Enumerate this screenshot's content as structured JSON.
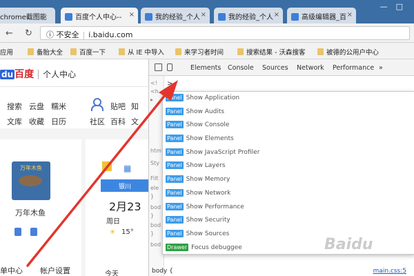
{
  "browser": {
    "tabs": [
      {
        "label": "chrome截图能"
      },
      {
        "label": "百度个人中心--"
      },
      {
        "label": "我的经验_个人"
      },
      {
        "label": "我的经验_个人"
      },
      {
        "label": "高级编辑器_百"
      }
    ],
    "url": "i.baidu.com",
    "security_label": "不安全",
    "bookmarks": [
      "应用",
      "备胎大全",
      "百度一下",
      "从 IE 中导入",
      "来学习者时间",
      "搜索结果 - 沃森搜客",
      "被德的公用户中心"
    ]
  },
  "page": {
    "logo_text": "百度",
    "logo_du": "du",
    "header_title": "个人中心",
    "menu_row1": [
      "搜索",
      "云盘",
      "糯米"
    ],
    "menu_row2": [
      "文库",
      "收藏",
      "日历"
    ],
    "menu_right1": [
      "贴吧",
      "知"
    ],
    "menu_right2": [
      "社区",
      "百科",
      "文"
    ],
    "avatar_label": "万年木鱼",
    "fish_caption": "万年木鱼",
    "date": "2月23",
    "weekday": "周日",
    "temp": "15°",
    "bottom_links": [
      "单中心",
      "帐户设置"
    ],
    "today_label": "今天",
    "blue_btn_label": "银川"
  },
  "devtools": {
    "tabs": [
      "Elements",
      "Console",
      "Sources",
      "Network",
      "Performance",
      "»"
    ],
    "prompt": ">",
    "gutter": [
      "<!",
      "<h",
      "▸",
      "htm",
      "Sty",
      "Filt",
      "ele",
      "}",
      "bod",
      "}",
      "bod",
      "}",
      "bod"
    ],
    "commands": [
      {
        "badge": "Panel",
        "text": "Show Application"
      },
      {
        "badge": "Panel",
        "text": "Show Audits"
      },
      {
        "badge": "Panel",
        "text": "Show Console"
      },
      {
        "badge": "Panel",
        "text": "Show Elements"
      },
      {
        "badge": "Panel",
        "text": "Show JavaScript Profiler"
      },
      {
        "badge": "Panel",
        "text": "Show Layers"
      },
      {
        "badge": "Panel",
        "text": "Show Memory"
      },
      {
        "badge": "Panel",
        "text": "Show Network"
      },
      {
        "badge": "Panel",
        "text": "Show Performance"
      },
      {
        "badge": "Panel",
        "text": "Show Security"
      },
      {
        "badge": "Panel",
        "text": "Show Sources"
      },
      {
        "badge": "Drawer",
        "text": "Focus debuggee"
      }
    ],
    "styles_text": "body {",
    "styles_link": "main.css:5"
  },
  "watermark": "Baidu"
}
